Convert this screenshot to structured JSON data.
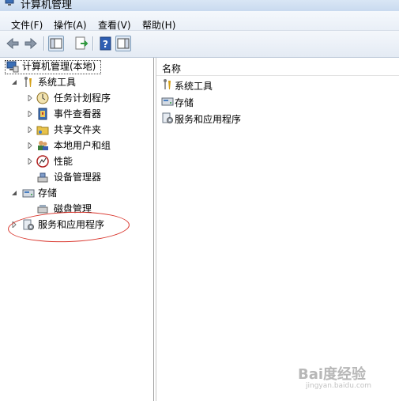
{
  "window": {
    "title": "计算机管理"
  },
  "menu": [
    "文件(F)",
    "操作(A)",
    "查看(V)",
    "帮助(H)"
  ],
  "toolbar": {
    "buttons": [
      "back-icon",
      "forward-icon",
      "show-hide-tree-icon",
      "export-list-icon",
      "help-icon",
      "properties-icon"
    ]
  },
  "tree": {
    "root": "计算机管理(本地)",
    "system_tools": "系统工具",
    "task_scheduler": "任务计划程序",
    "event_viewer": "事件查看器",
    "shared_folders": "共享文件夹",
    "local_users": "本地用户和组",
    "performance": "性能",
    "device_manager": "设备管理器",
    "storage": "存储",
    "disk_management": "磁盘管理",
    "services_apps": "服务和应用程序"
  },
  "right": {
    "column_header": "名称",
    "items": [
      "系统工具",
      "存储",
      "服务和应用程序"
    ]
  },
  "watermark": {
    "brand": "Bai度经验",
    "sub": "jingyan.baidu.com"
  },
  "colors": {
    "highlight_circle": "#d9342b",
    "toolbar_bg": "#e4ebf4"
  }
}
